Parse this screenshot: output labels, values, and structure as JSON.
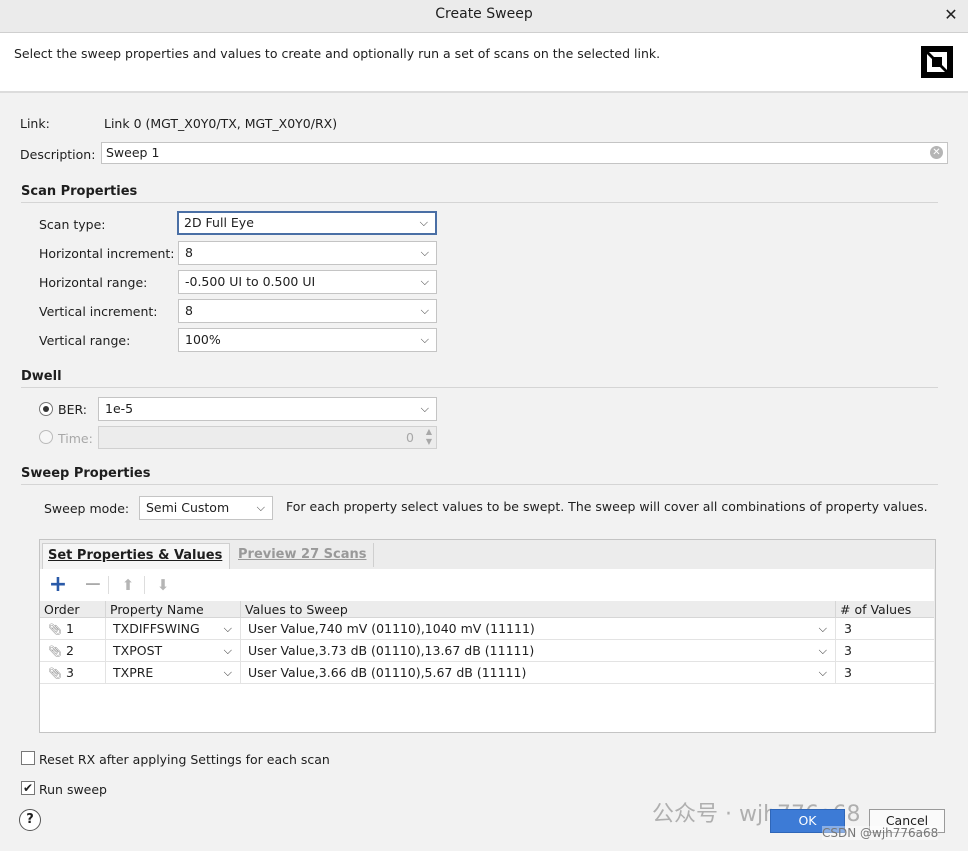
{
  "window": {
    "title": "Create Sweep",
    "close_glyph": "✕"
  },
  "header": {
    "description": "Select the sweep properties and values to create and optionally run a set of scans on the selected link."
  },
  "link": {
    "label": "Link:",
    "value": "Link 0 (MGT_X0Y0/TX, MGT_X0Y0/RX)"
  },
  "description_field": {
    "label": "Description:",
    "value": "Sweep 1"
  },
  "scan_properties": {
    "heading": "Scan Properties",
    "scan_type": {
      "label": "Scan type:",
      "value": "2D Full Eye"
    },
    "horizontal_increment": {
      "label": "Horizontal increment:",
      "value": "8"
    },
    "horizontal_range": {
      "label": "Horizontal range:",
      "value": "-0.500 UI to 0.500 UI"
    },
    "vertical_increment": {
      "label": "Vertical increment:",
      "value": "8"
    },
    "vertical_range": {
      "label": "Vertical range:",
      "value": "100%"
    }
  },
  "dwell": {
    "heading": "Dwell",
    "ber": {
      "label": "BER:",
      "value": "1e-5",
      "selected": true
    },
    "time": {
      "label": "Time:",
      "value": "0",
      "selected": false
    }
  },
  "sweep_properties": {
    "heading": "Sweep Properties",
    "sweep_mode": {
      "label": "Sweep mode:",
      "value": "Semi Custom"
    },
    "hint": "For each property select values to be swept. The sweep will cover all combinations of property values.",
    "tabs": [
      {
        "label": "Set Properties & Values",
        "active": true
      },
      {
        "label": "Preview 27 Scans",
        "active": false
      }
    ],
    "toolbar": {
      "add": "+",
      "remove": "−",
      "up": "⬆",
      "down": "⬇"
    },
    "table": {
      "columns": [
        "Order",
        "Property Name",
        "Values to Sweep",
        "# of Values"
      ],
      "rows": [
        {
          "order": "1",
          "property": "TXDIFFSWING",
          "values": "User Value,740 mV (01110),1040 mV (11111)",
          "count": "3"
        },
        {
          "order": "2",
          "property": "TXPOST",
          "values": "User Value,3.73 dB (01110),13.67 dB (11111)",
          "count": "3"
        },
        {
          "order": "3",
          "property": "TXPRE",
          "values": "User Value,3.66 dB (01110),5.67 dB (11111)",
          "count": "3"
        }
      ]
    }
  },
  "options": {
    "reset_rx": {
      "label": "Reset RX after applying Settings for each scan",
      "checked": false
    },
    "run_sweep": {
      "label": "Run sweep",
      "checked": true
    }
  },
  "buttons": {
    "help": "?",
    "ok": "OK",
    "cancel": "Cancel"
  },
  "watermark": {
    "brand": "公众号 · wjh776a68",
    "csdn": "CSDN @wjh776a68"
  },
  "colors": {
    "ok_button": "#3d7bd6",
    "focus_border": "#4a6fa5"
  }
}
